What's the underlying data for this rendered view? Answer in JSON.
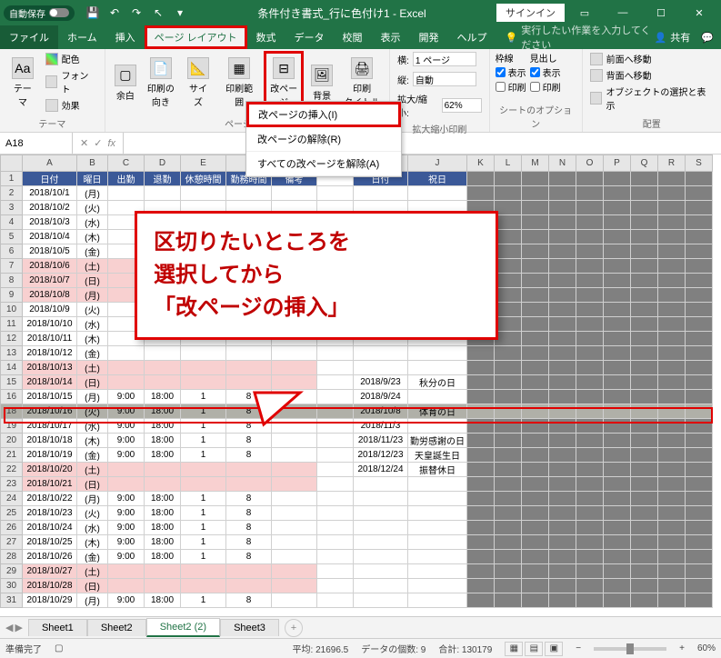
{
  "titlebar": {
    "autosave": "自動保存",
    "title": "条件付き書式_行に色付け1 - Excel",
    "signin": "サインイン"
  },
  "menubar": {
    "file": "ファイル",
    "home": "ホーム",
    "insert": "挿入",
    "pagelayout": "ページ レイアウト",
    "formulas": "数式",
    "data": "データ",
    "review": "校閲",
    "view": "表示",
    "developer": "開発",
    "help": "ヘルプ",
    "tellme": "実行したい作業を入力してください",
    "share": "共有"
  },
  "ribbon": {
    "theme_group": "テーマ",
    "theme": "テーマ",
    "colors": "配色",
    "fonts": "フォント",
    "effects": "効果",
    "margins": "余白",
    "orientation": "印刷の\n向き",
    "size": "サイズ",
    "printarea": "印刷範囲",
    "breaks": "改ペー\nジ",
    "background": "背景",
    "printtitles": "印刷\nタイトル",
    "pagesetup_group": "ページ設定",
    "width": "横:",
    "width_val": "1 ページ",
    "height": "縦:",
    "height_val": "自動",
    "scale": "拡大/縮小:",
    "scale_val": "62%",
    "scale_group": "拡大縮小印刷",
    "gridlines": "枠線",
    "headings": "見出し",
    "view_chk": "表示",
    "print_chk": "印刷",
    "sheetopt_group": "シートのオプション",
    "forward": "前面へ移動",
    "backward": "背面へ移動",
    "selpane": "オブジェクトの選択と表示",
    "arrange_group": "配置"
  },
  "dropdown": {
    "insert": "改ページの挿入(I)",
    "remove": "改ページの解除(R)",
    "reset": "すべての改ページを解除(A)"
  },
  "namebox": "A18",
  "fx": "fx",
  "callout": {
    "l1": "区切りたいところを",
    "l2": "選択してから",
    "l3": "「改ページの挿入」"
  },
  "headers": {
    "date": "日付",
    "dow": "曜日",
    "in": "出勤",
    "out": "退勤",
    "break": "休憩時間",
    "work": "勤務時間",
    "note": "備考",
    "date2": "日付",
    "holiday": "祝日"
  },
  "rows": [
    {
      "r": "2",
      "d": "2018/10/1",
      "w": "(月)",
      "pink": false
    },
    {
      "r": "3",
      "d": "2018/10/2",
      "w": "(火)",
      "pink": false
    },
    {
      "r": "4",
      "d": "2018/10/3",
      "w": "(水)",
      "pink": false
    },
    {
      "r": "5",
      "d": "2018/10/4",
      "w": "(木)",
      "pink": false
    },
    {
      "r": "6",
      "d": "2018/10/5",
      "w": "(金)",
      "pink": false
    },
    {
      "r": "7",
      "d": "2018/10/6",
      "w": "(土)",
      "pink": true
    },
    {
      "r": "8",
      "d": "2018/10/7",
      "w": "(日)",
      "pink": true
    },
    {
      "r": "9",
      "d": "2018/10/8",
      "w": "(月)",
      "pink": true
    },
    {
      "r": "10",
      "d": "2018/10/9",
      "w": "(火)",
      "pink": false
    },
    {
      "r": "11",
      "d": "2018/10/10",
      "w": "(水)",
      "pink": false
    },
    {
      "r": "12",
      "d": "2018/10/11",
      "w": "(木)",
      "pink": false
    },
    {
      "r": "13",
      "d": "2018/10/12",
      "w": "(金)",
      "pink": false
    },
    {
      "r": "14",
      "d": "2018/10/13",
      "w": "(土)",
      "pink": true
    },
    {
      "r": "15",
      "d": "2018/10/14",
      "w": "(日)",
      "pink": true,
      "h_d": "2018/9/23",
      "h_n": "秋分の日"
    },
    {
      "r": "16",
      "d": "2018/10/15",
      "w": "(月)",
      "in": "9:00",
      "out": "18:00",
      "br": "1",
      "wk": "8",
      "h_d": "2018/9/24"
    },
    {
      "r": "18",
      "d": "2018/10/16",
      "w": "(火)",
      "in": "9:00",
      "out": "18:00",
      "br": "1",
      "wk": "8",
      "h_d": "2018/10/8",
      "h_n": "体育の日",
      "sel": true
    },
    {
      "r": "19",
      "d": "2018/10/17",
      "w": "(水)",
      "in": "9:00",
      "out": "18:00",
      "br": "1",
      "wk": "8",
      "h_d": "2018/11/3"
    },
    {
      "r": "20",
      "d": "2018/10/18",
      "w": "(木)",
      "in": "9:00",
      "out": "18:00",
      "br": "1",
      "wk": "8",
      "h_d": "2018/11/23",
      "h_n": "勤労感謝の日"
    },
    {
      "r": "21",
      "d": "2018/10/19",
      "w": "(金)",
      "in": "9:00",
      "out": "18:00",
      "br": "1",
      "wk": "8",
      "h_d": "2018/12/23",
      "h_n": "天皇誕生日"
    },
    {
      "r": "22",
      "d": "2018/10/20",
      "w": "(土)",
      "pink": true,
      "h_d": "2018/12/24",
      "h_n": "振替休日"
    },
    {
      "r": "23",
      "d": "2018/10/21",
      "w": "(日)",
      "pink": true
    },
    {
      "r": "24",
      "d": "2018/10/22",
      "w": "(月)",
      "in": "9:00",
      "out": "18:00",
      "br": "1",
      "wk": "8"
    },
    {
      "r": "25",
      "d": "2018/10/23",
      "w": "(火)",
      "in": "9:00",
      "out": "18:00",
      "br": "1",
      "wk": "8"
    },
    {
      "r": "26",
      "d": "2018/10/24",
      "w": "(水)",
      "in": "9:00",
      "out": "18:00",
      "br": "1",
      "wk": "8"
    },
    {
      "r": "27",
      "d": "2018/10/25",
      "w": "(木)",
      "in": "9:00",
      "out": "18:00",
      "br": "1",
      "wk": "8"
    },
    {
      "r": "28",
      "d": "2018/10/26",
      "w": "(金)",
      "in": "9:00",
      "out": "18:00",
      "br": "1",
      "wk": "8"
    },
    {
      "r": "29",
      "d": "2018/10/27",
      "w": "(土)",
      "pink": true
    },
    {
      "r": "30",
      "d": "2018/10/28",
      "w": "(日)",
      "pink": true
    },
    {
      "r": "31",
      "d": "2018/10/29",
      "w": "(月)",
      "in": "9:00",
      "out": "18:00",
      "br": "1",
      "wk": "8"
    }
  ],
  "colheaders": [
    "A",
    "B",
    "C",
    "D",
    "E",
    "F",
    "G",
    "H",
    "I",
    "J",
    "K",
    "L",
    "M",
    "N",
    "O",
    "P",
    "Q",
    "R",
    "S"
  ],
  "tabs": {
    "s1": "Sheet1",
    "s2": "Sheet2",
    "s2b": "Sheet2 (2)",
    "s3": "Sheet3"
  },
  "status": {
    "ready": "準備完了",
    "avg": "平均: 21696.5",
    "count": "データの個数: 9",
    "sum": "合計: 130179",
    "zoom": "60%"
  }
}
